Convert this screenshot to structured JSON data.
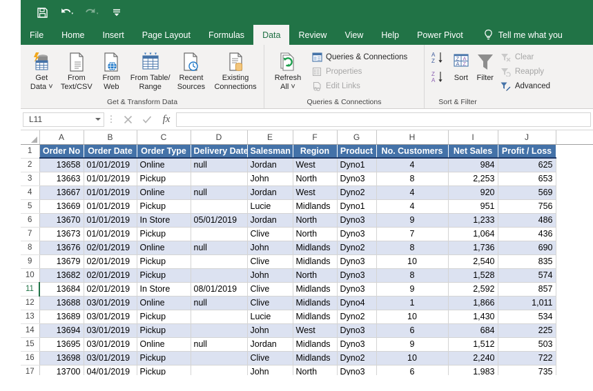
{
  "app": {
    "accent_green": "#217346",
    "table_header_fill": "#4472a8",
    "band_fill": "#dce2f1"
  },
  "quick_access": {
    "items": [
      {
        "name": "save-icon",
        "label": "Save",
        "enabled": true
      },
      {
        "name": "undo-icon",
        "label": "Undo",
        "enabled": true
      },
      {
        "name": "redo-icon",
        "label": "Redo",
        "enabled": false
      },
      {
        "name": "customize-quick-access-icon",
        "label": "Customize Quick Access Toolbar",
        "enabled": true
      }
    ]
  },
  "ribbon_tabs": {
    "items": [
      {
        "label": "File",
        "active": false
      },
      {
        "label": "Home",
        "active": false
      },
      {
        "label": "Insert",
        "active": false
      },
      {
        "label": "Page Layout",
        "active": false
      },
      {
        "label": "Formulas",
        "active": false
      },
      {
        "label": "Data",
        "active": true
      },
      {
        "label": "Review",
        "active": false
      },
      {
        "label": "View",
        "active": false
      },
      {
        "label": "Help",
        "active": false
      },
      {
        "label": "Power Pivot",
        "active": false
      }
    ],
    "tell_me": "Tell me what you"
  },
  "ribbon": {
    "groups": [
      {
        "title": "Get & Transform Data",
        "big_buttons": [
          {
            "label": "Get\nData ˅",
            "icon": "get-data-icon"
          },
          {
            "label": "From\nText/CSV",
            "icon": "from-text-csv-icon"
          },
          {
            "label": "From\nWeb",
            "icon": "from-web-icon"
          },
          {
            "label": "From Table/\nRange",
            "icon": "from-table-range-icon"
          },
          {
            "label": "Recent\nSources",
            "icon": "recent-sources-icon"
          },
          {
            "label": "Existing\nConnections",
            "icon": "existing-connections-icon"
          }
        ]
      },
      {
        "title": "Queries & Connections",
        "big_buttons": [
          {
            "label": "Refresh\nAll ˅",
            "icon": "refresh-all-icon"
          }
        ],
        "small_buttons": [
          {
            "label": "Queries & Connections",
            "icon": "queries-connections-icon",
            "enabled": true
          },
          {
            "label": "Properties",
            "icon": "properties-icon",
            "enabled": false
          },
          {
            "label": "Edit Links",
            "icon": "edit-links-icon",
            "enabled": false
          }
        ]
      },
      {
        "title": "Sort & Filter",
        "sort_buttons": [
          {
            "label": "",
            "icon": "sort-ascending-icon"
          },
          {
            "label": "",
            "icon": "sort-descending-icon"
          },
          {
            "label": "Sort",
            "icon": "sort-dialog-icon"
          },
          {
            "label": "Filter",
            "icon": "filter-icon"
          }
        ],
        "small_buttons": [
          {
            "label": "Clear",
            "icon": "clear-filter-icon",
            "enabled": false
          },
          {
            "label": "Reapply",
            "icon": "reapply-filter-icon",
            "enabled": false
          },
          {
            "label": "Advanced",
            "icon": "advanced-filter-icon",
            "enabled": true
          }
        ]
      }
    ]
  },
  "formula_bar": {
    "name_box_value": "L11",
    "formula_value": "",
    "cancel_icon": "cancel-icon",
    "enter_icon": "enter-icon",
    "fx_icon": "insert-function-icon"
  },
  "sheet": {
    "column_letters": [
      "A",
      "B",
      "C",
      "D",
      "E",
      "F",
      "G",
      "H",
      "I",
      "J"
    ],
    "selected_row": 11,
    "header_row_number": 1,
    "headers": [
      "Order No",
      "Order Date",
      "Order Type",
      "Delivery Date",
      "Salesman",
      "Region",
      "Product",
      "No. Customers",
      "Net Sales",
      "Profit / Loss"
    ],
    "rows": [
      {
        "n": 2,
        "cells": [
          "13658",
          "01/01/2019",
          "Online",
          "null",
          "Jordan",
          "West",
          "Dyno1",
          "4",
          "984",
          "625"
        ]
      },
      {
        "n": 3,
        "cells": [
          "13663",
          "01/01/2019",
          "Pickup",
          "",
          "John",
          "North",
          "Dyno3",
          "8",
          "2,253",
          "653"
        ]
      },
      {
        "n": 4,
        "cells": [
          "13667",
          "01/01/2019",
          "Online",
          "null",
          "Jordan",
          "West",
          "Dyno2",
          "4",
          "920",
          "569"
        ]
      },
      {
        "n": 5,
        "cells": [
          "13669",
          "01/01/2019",
          "Pickup",
          "",
          "Lucie",
          "Midlands",
          "Dyno1",
          "4",
          "951",
          "756"
        ]
      },
      {
        "n": 6,
        "cells": [
          "13670",
          "01/01/2019",
          "In Store",
          "05/01/2019",
          "Jordan",
          "North",
          "Dyno3",
          "9",
          "1,233",
          "486"
        ]
      },
      {
        "n": 7,
        "cells": [
          "13673",
          "01/01/2019",
          "Pickup",
          "",
          "Clive",
          "North",
          "Dyno3",
          "7",
          "1,064",
          "436"
        ]
      },
      {
        "n": 8,
        "cells": [
          "13676",
          "02/01/2019",
          "Online",
          "null",
          "John",
          "Midlands",
          "Dyno2",
          "8",
          "1,736",
          "690"
        ]
      },
      {
        "n": 9,
        "cells": [
          "13679",
          "02/01/2019",
          "Pickup",
          "",
          "Clive",
          "Midlands",
          "Dyno3",
          "10",
          "2,540",
          "835"
        ]
      },
      {
        "n": 10,
        "cells": [
          "13682",
          "02/01/2019",
          "Pickup",
          "",
          "John",
          "North",
          "Dyno3",
          "8",
          "1,528",
          "574"
        ]
      },
      {
        "n": 11,
        "cells": [
          "13684",
          "02/01/2019",
          "In Store",
          "08/01/2019",
          "Clive",
          "Midlands",
          "Dyno3",
          "9",
          "2,592",
          "857"
        ]
      },
      {
        "n": 12,
        "cells": [
          "13688",
          "03/01/2019",
          "Online",
          "null",
          "Clive",
          "Midlands",
          "Dyno4",
          "1",
          "1,866",
          "1,011"
        ]
      },
      {
        "n": 13,
        "cells": [
          "13689",
          "03/01/2019",
          "Pickup",
          "",
          "Lucie",
          "Midlands",
          "Dyno2",
          "10",
          "1,430",
          "534"
        ]
      },
      {
        "n": 14,
        "cells": [
          "13694",
          "03/01/2019",
          "Pickup",
          "",
          "John",
          "West",
          "Dyno3",
          "6",
          "684",
          "225"
        ]
      },
      {
        "n": 15,
        "cells": [
          "13695",
          "03/01/2019",
          "Online",
          "null",
          "Jordan",
          "Midlands",
          "Dyno3",
          "9",
          "1,512",
          "503"
        ]
      },
      {
        "n": 16,
        "cells": [
          "13698",
          "03/01/2019",
          "Pickup",
          "",
          "Clive",
          "Midlands",
          "Dyno2",
          "10",
          "2,240",
          "722"
        ]
      },
      {
        "n": 17,
        "cells": [
          "13700",
          "04/01/2019",
          "Pickup",
          "",
          "John",
          "North",
          "Dyno3",
          "6",
          "1,983",
          "735"
        ]
      }
    ]
  }
}
